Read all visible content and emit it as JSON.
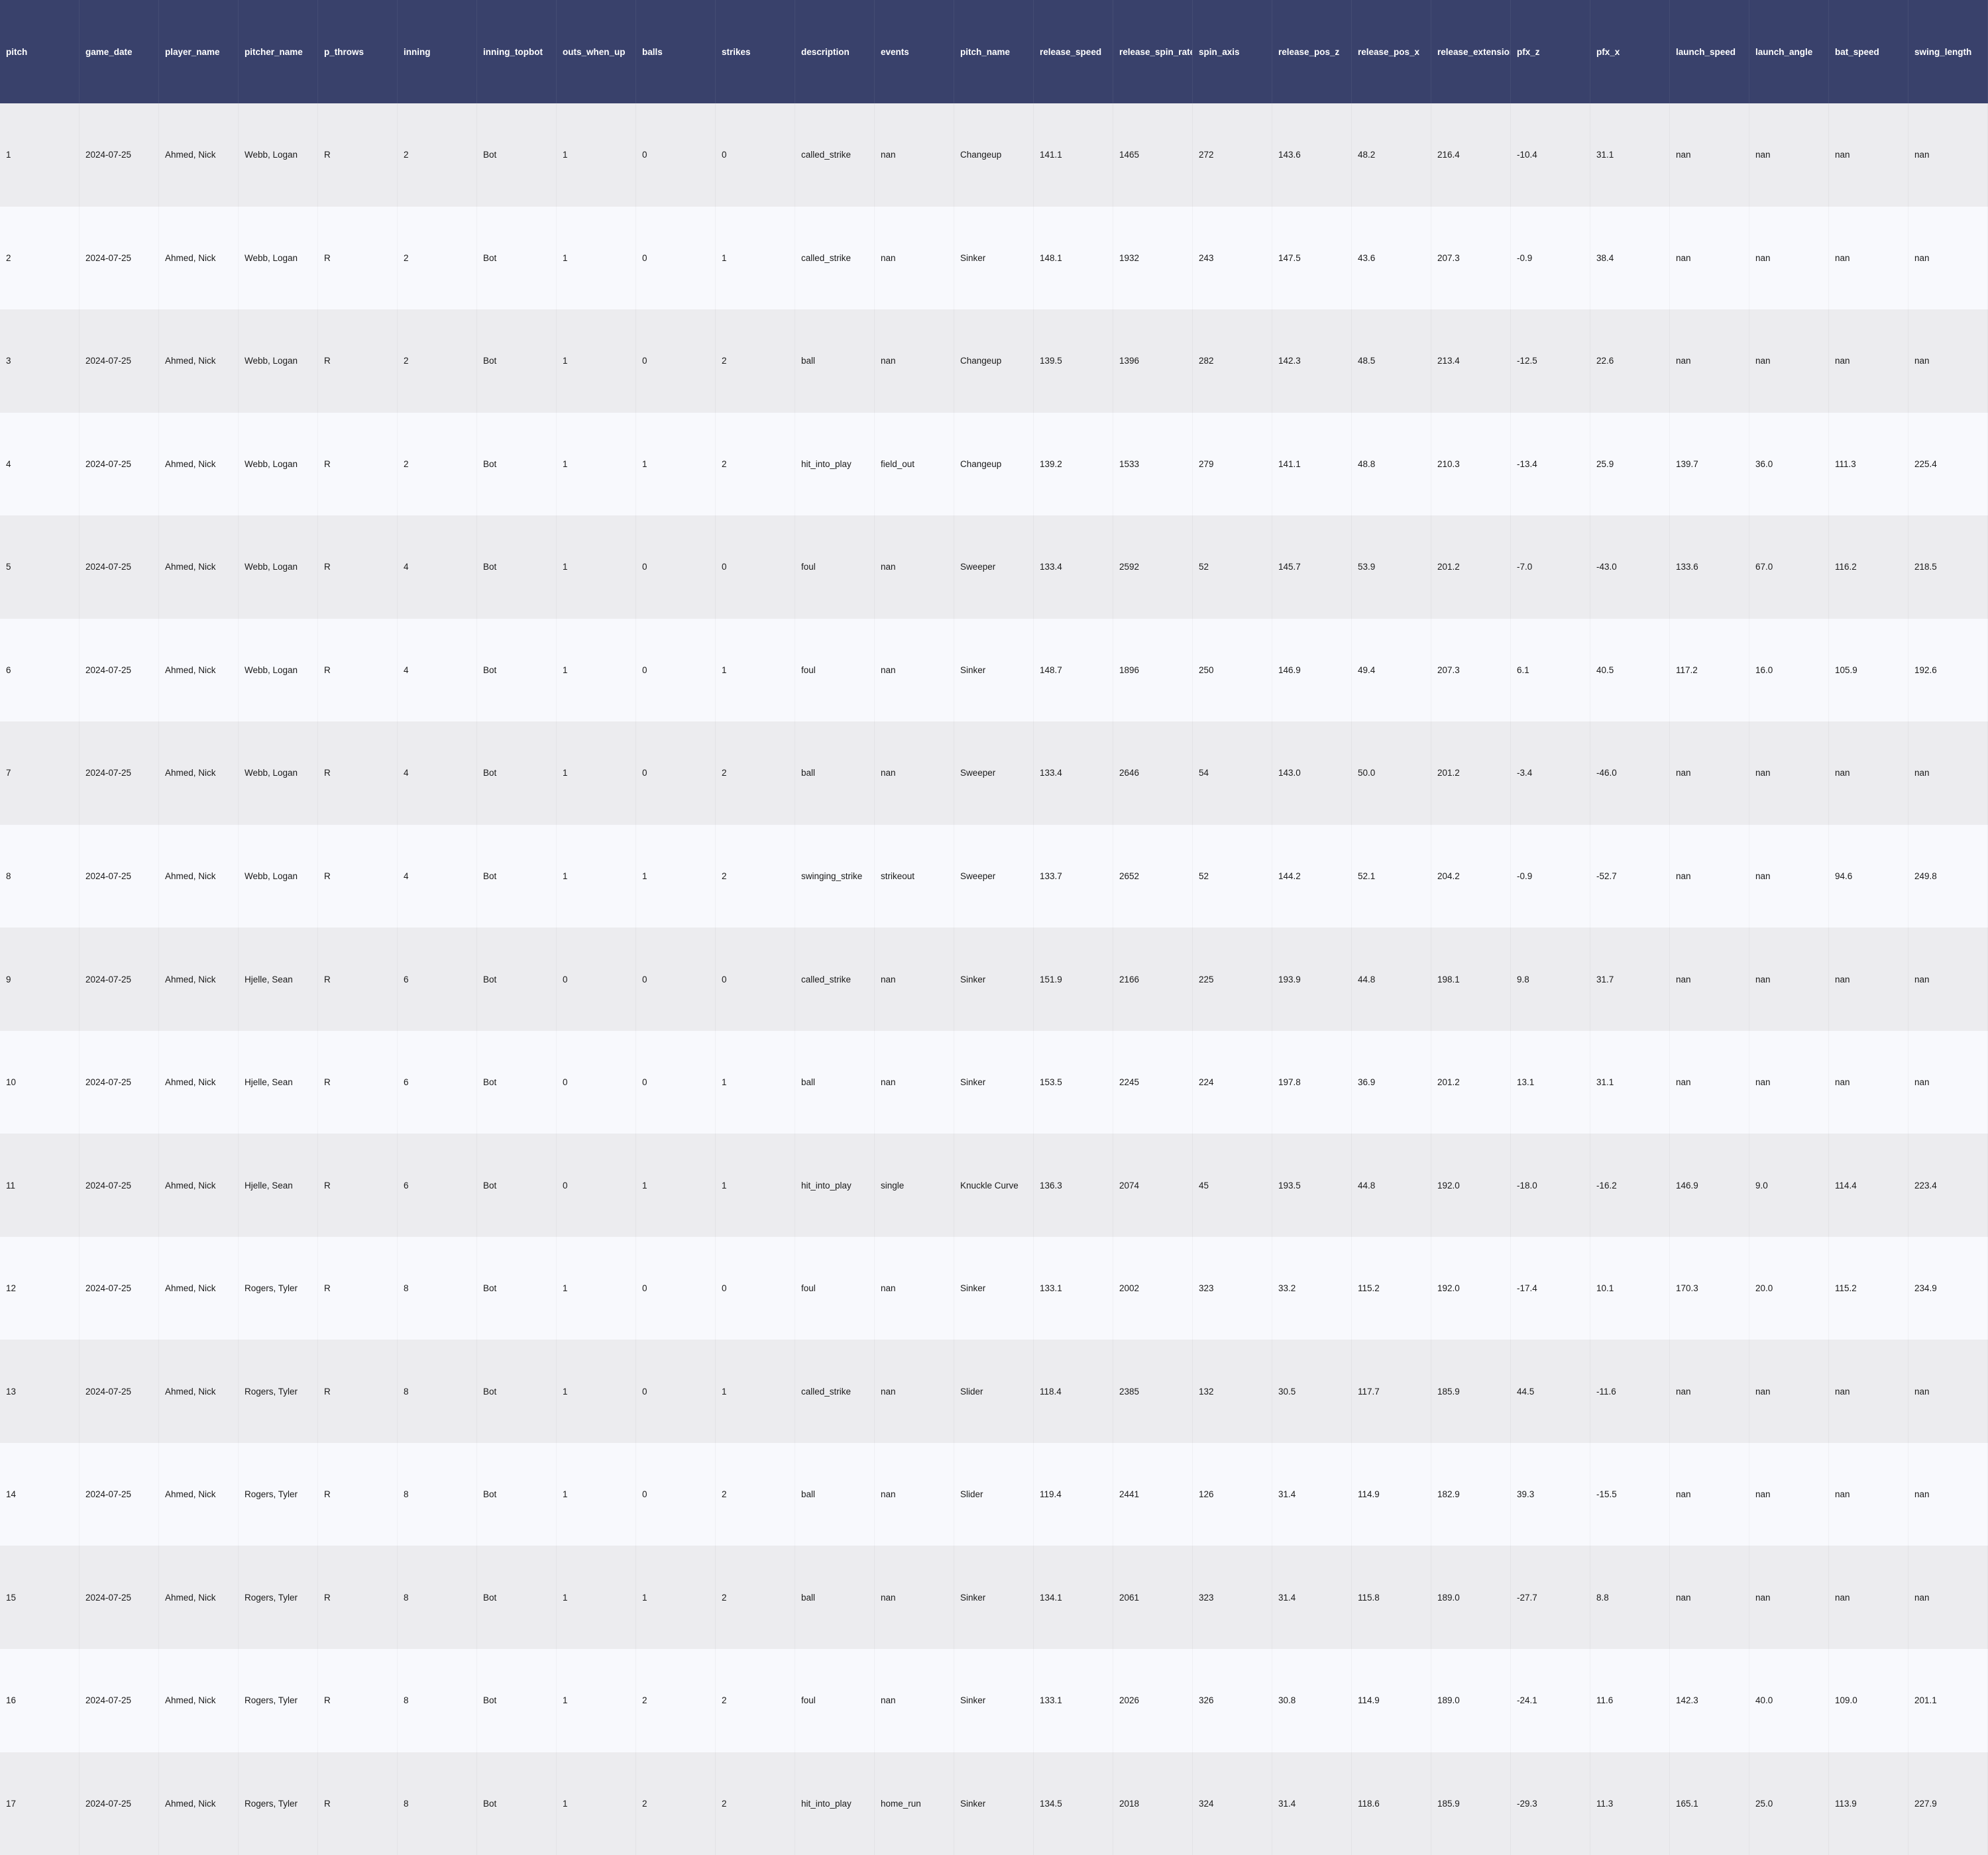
{
  "table": {
    "columns": [
      "pitch",
      "game_date",
      "player_name",
      "pitcher_name",
      "p_throws",
      "inning",
      "inning_topbot",
      "outs_when_up",
      "balls",
      "strikes",
      "description",
      "events",
      "pitch_name",
      "release_speed",
      "release_spin_rate",
      "spin_axis",
      "release_pos_z",
      "release_pos_x",
      "release_extension",
      "pfx_z",
      "pfx_x",
      "launch_speed",
      "launch_angle",
      "bat_speed",
      "swing_length"
    ],
    "rows": [
      [
        "1",
        "2024-07-25",
        "Ahmed, Nick",
        "Webb, Logan",
        "R",
        "2",
        "Bot",
        "1",
        "0",
        "0",
        "called_strike",
        "nan",
        "Changeup",
        "141.1",
        "1465",
        "272",
        "143.6",
        "48.2",
        "216.4",
        "-10.4",
        "31.1",
        "nan",
        "nan",
        "nan",
        "nan"
      ],
      [
        "2",
        "2024-07-25",
        "Ahmed, Nick",
        "Webb, Logan",
        "R",
        "2",
        "Bot",
        "1",
        "0",
        "1",
        "called_strike",
        "nan",
        "Sinker",
        "148.1",
        "1932",
        "243",
        "147.5",
        "43.6",
        "207.3",
        "-0.9",
        "38.4",
        "nan",
        "nan",
        "nan",
        "nan"
      ],
      [
        "3",
        "2024-07-25",
        "Ahmed, Nick",
        "Webb, Logan",
        "R",
        "2",
        "Bot",
        "1",
        "0",
        "2",
        "ball",
        "nan",
        "Changeup",
        "139.5",
        "1396",
        "282",
        "142.3",
        "48.5",
        "213.4",
        "-12.5",
        "22.6",
        "nan",
        "nan",
        "nan",
        "nan"
      ],
      [
        "4",
        "2024-07-25",
        "Ahmed, Nick",
        "Webb, Logan",
        "R",
        "2",
        "Bot",
        "1",
        "1",
        "2",
        "hit_into_play",
        "field_out",
        "Changeup",
        "139.2",
        "1533",
        "279",
        "141.1",
        "48.8",
        "210.3",
        "-13.4",
        "25.9",
        "139.7",
        "36.0",
        "111.3",
        "225.4"
      ],
      [
        "5",
        "2024-07-25",
        "Ahmed, Nick",
        "Webb, Logan",
        "R",
        "4",
        "Bot",
        "1",
        "0",
        "0",
        "foul",
        "nan",
        "Sweeper",
        "133.4",
        "2592",
        "52",
        "145.7",
        "53.9",
        "201.2",
        "-7.0",
        "-43.0",
        "133.6",
        "67.0",
        "116.2",
        "218.5"
      ],
      [
        "6",
        "2024-07-25",
        "Ahmed, Nick",
        "Webb, Logan",
        "R",
        "4",
        "Bot",
        "1",
        "0",
        "1",
        "foul",
        "nan",
        "Sinker",
        "148.7",
        "1896",
        "250",
        "146.9",
        "49.4",
        "207.3",
        "6.1",
        "40.5",
        "117.2",
        "16.0",
        "105.9",
        "192.6"
      ],
      [
        "7",
        "2024-07-25",
        "Ahmed, Nick",
        "Webb, Logan",
        "R",
        "4",
        "Bot",
        "1",
        "0",
        "2",
        "ball",
        "nan",
        "Sweeper",
        "133.4",
        "2646",
        "54",
        "143.0",
        "50.0",
        "201.2",
        "-3.4",
        "-46.0",
        "nan",
        "nan",
        "nan",
        "nan"
      ],
      [
        "8",
        "2024-07-25",
        "Ahmed, Nick",
        "Webb, Logan",
        "R",
        "4",
        "Bot",
        "1",
        "1",
        "2",
        "swinging_strike",
        "strikeout",
        "Sweeper",
        "133.7",
        "2652",
        "52",
        "144.2",
        "52.1",
        "204.2",
        "-0.9",
        "-52.7",
        "nan",
        "nan",
        "94.6",
        "249.8"
      ],
      [
        "9",
        "2024-07-25",
        "Ahmed, Nick",
        "Hjelle, Sean",
        "R",
        "6",
        "Bot",
        "0",
        "0",
        "0",
        "called_strike",
        "nan",
        "Sinker",
        "151.9",
        "2166",
        "225",
        "193.9",
        "44.8",
        "198.1",
        "9.8",
        "31.7",
        "nan",
        "nan",
        "nan",
        "nan"
      ],
      [
        "10",
        "2024-07-25",
        "Ahmed, Nick",
        "Hjelle, Sean",
        "R",
        "6",
        "Bot",
        "0",
        "0",
        "1",
        "ball",
        "nan",
        "Sinker",
        "153.5",
        "2245",
        "224",
        "197.8",
        "36.9",
        "201.2",
        "13.1",
        "31.1",
        "nan",
        "nan",
        "nan",
        "nan"
      ],
      [
        "11",
        "2024-07-25",
        "Ahmed, Nick",
        "Hjelle, Sean",
        "R",
        "6",
        "Bot",
        "0",
        "1",
        "1",
        "hit_into_play",
        "single",
        "Knuckle Curve",
        "136.3",
        "2074",
        "45",
        "193.5",
        "44.8",
        "192.0",
        "-18.0",
        "-16.2",
        "146.9",
        "9.0",
        "114.4",
        "223.4"
      ],
      [
        "12",
        "2024-07-25",
        "Ahmed, Nick",
        "Rogers, Tyler",
        "R",
        "8",
        "Bot",
        "1",
        "0",
        "0",
        "foul",
        "nan",
        "Sinker",
        "133.1",
        "2002",
        "323",
        "33.2",
        "115.2",
        "192.0",
        "-17.4",
        "10.1",
        "170.3",
        "20.0",
        "115.2",
        "234.9"
      ],
      [
        "13",
        "2024-07-25",
        "Ahmed, Nick",
        "Rogers, Tyler",
        "R",
        "8",
        "Bot",
        "1",
        "0",
        "1",
        "called_strike",
        "nan",
        "Slider",
        "118.4",
        "2385",
        "132",
        "30.5",
        "117.7",
        "185.9",
        "44.5",
        "-11.6",
        "nan",
        "nan",
        "nan",
        "nan"
      ],
      [
        "14",
        "2024-07-25",
        "Ahmed, Nick",
        "Rogers, Tyler",
        "R",
        "8",
        "Bot",
        "1",
        "0",
        "2",
        "ball",
        "nan",
        "Slider",
        "119.4",
        "2441",
        "126",
        "31.4",
        "114.9",
        "182.9",
        "39.3",
        "-15.5",
        "nan",
        "nan",
        "nan",
        "nan"
      ],
      [
        "15",
        "2024-07-25",
        "Ahmed, Nick",
        "Rogers, Tyler",
        "R",
        "8",
        "Bot",
        "1",
        "1",
        "2",
        "ball",
        "nan",
        "Sinker",
        "134.1",
        "2061",
        "323",
        "31.4",
        "115.8",
        "189.0",
        "-27.7",
        "8.8",
        "nan",
        "nan",
        "nan",
        "nan"
      ],
      [
        "16",
        "2024-07-25",
        "Ahmed, Nick",
        "Rogers, Tyler",
        "R",
        "8",
        "Bot",
        "1",
        "2",
        "2",
        "foul",
        "nan",
        "Sinker",
        "133.1",
        "2026",
        "326",
        "30.8",
        "114.9",
        "189.0",
        "-24.1",
        "11.6",
        "142.3",
        "40.0",
        "109.0",
        "201.1"
      ],
      [
        "17",
        "2024-07-25",
        "Ahmed, Nick",
        "Rogers, Tyler",
        "R",
        "8",
        "Bot",
        "1",
        "2",
        "2",
        "hit_into_play",
        "home_run",
        "Sinker",
        "134.5",
        "2018",
        "324",
        "31.4",
        "118.6",
        "185.9",
        "-29.3",
        "11.3",
        "165.1",
        "25.0",
        "113.9",
        "227.9"
      ]
    ]
  },
  "colors": {
    "header_bg": "#39416b",
    "header_text": "#ffffff",
    "row_odd": "#ececef",
    "row_even": "#f8f9fd"
  }
}
